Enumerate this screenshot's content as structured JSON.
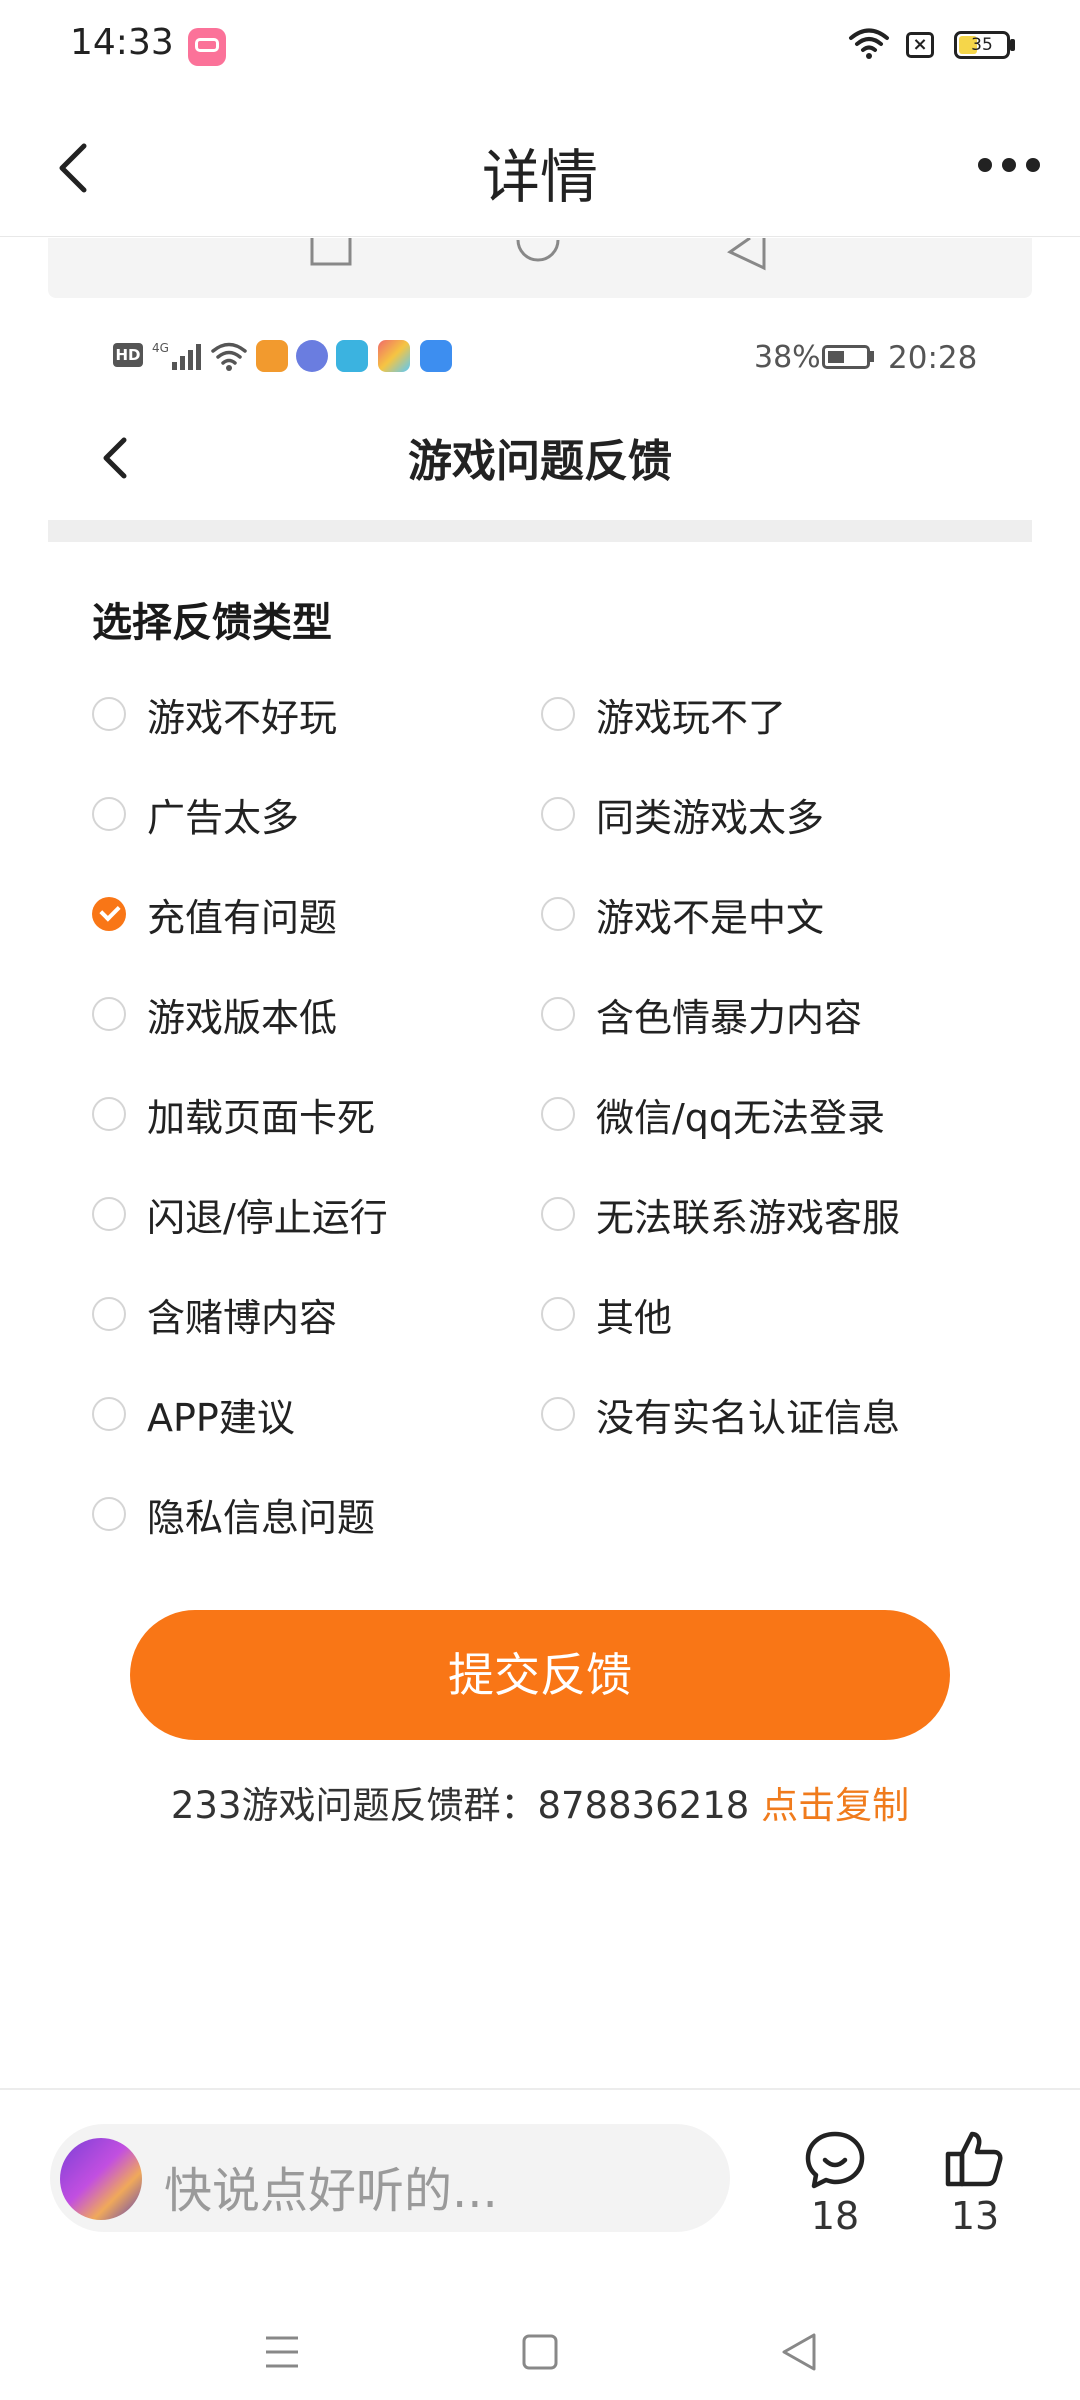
{
  "status_bar": {
    "time": "14:33",
    "battery": "35"
  },
  "header": {
    "title": "详情"
  },
  "embedded": {
    "status_bar": {
      "battery": "38%",
      "time": "20:28"
    },
    "title": "游戏问题反馈",
    "section_label": "选择反馈类型",
    "options": [
      {
        "label": "游戏不好玩",
        "checked": false
      },
      {
        "label": "游戏玩不了",
        "checked": false
      },
      {
        "label": "广告太多",
        "checked": false
      },
      {
        "label": "同类游戏太多",
        "checked": false
      },
      {
        "label": "充值有问题",
        "checked": true
      },
      {
        "label": "游戏不是中文",
        "checked": false
      },
      {
        "label": "游戏版本低",
        "checked": false
      },
      {
        "label": "含色情暴力内容",
        "checked": false
      },
      {
        "label": "加载页面卡死",
        "checked": false
      },
      {
        "label": "微信/qq无法登录",
        "checked": false
      },
      {
        "label": "闪退/停止运行",
        "checked": false
      },
      {
        "label": "无法联系游戏客服",
        "checked": false
      },
      {
        "label": "含赌博内容",
        "checked": false
      },
      {
        "label": "其他",
        "checked": false
      },
      {
        "label": "APP建议",
        "checked": false
      },
      {
        "label": "没有实名认证信息",
        "checked": false
      },
      {
        "label": "隐私信息问题",
        "checked": false
      }
    ],
    "submit_label": "提交反馈",
    "group_text": "233游戏问题反馈群：878836218",
    "copy_label": "点击复制"
  },
  "comment_bar": {
    "placeholder": "快说点好听的...",
    "comment_count": "18",
    "like_count": "13"
  },
  "colors": {
    "accent": "#f97616",
    "link": "#f07b1c"
  }
}
